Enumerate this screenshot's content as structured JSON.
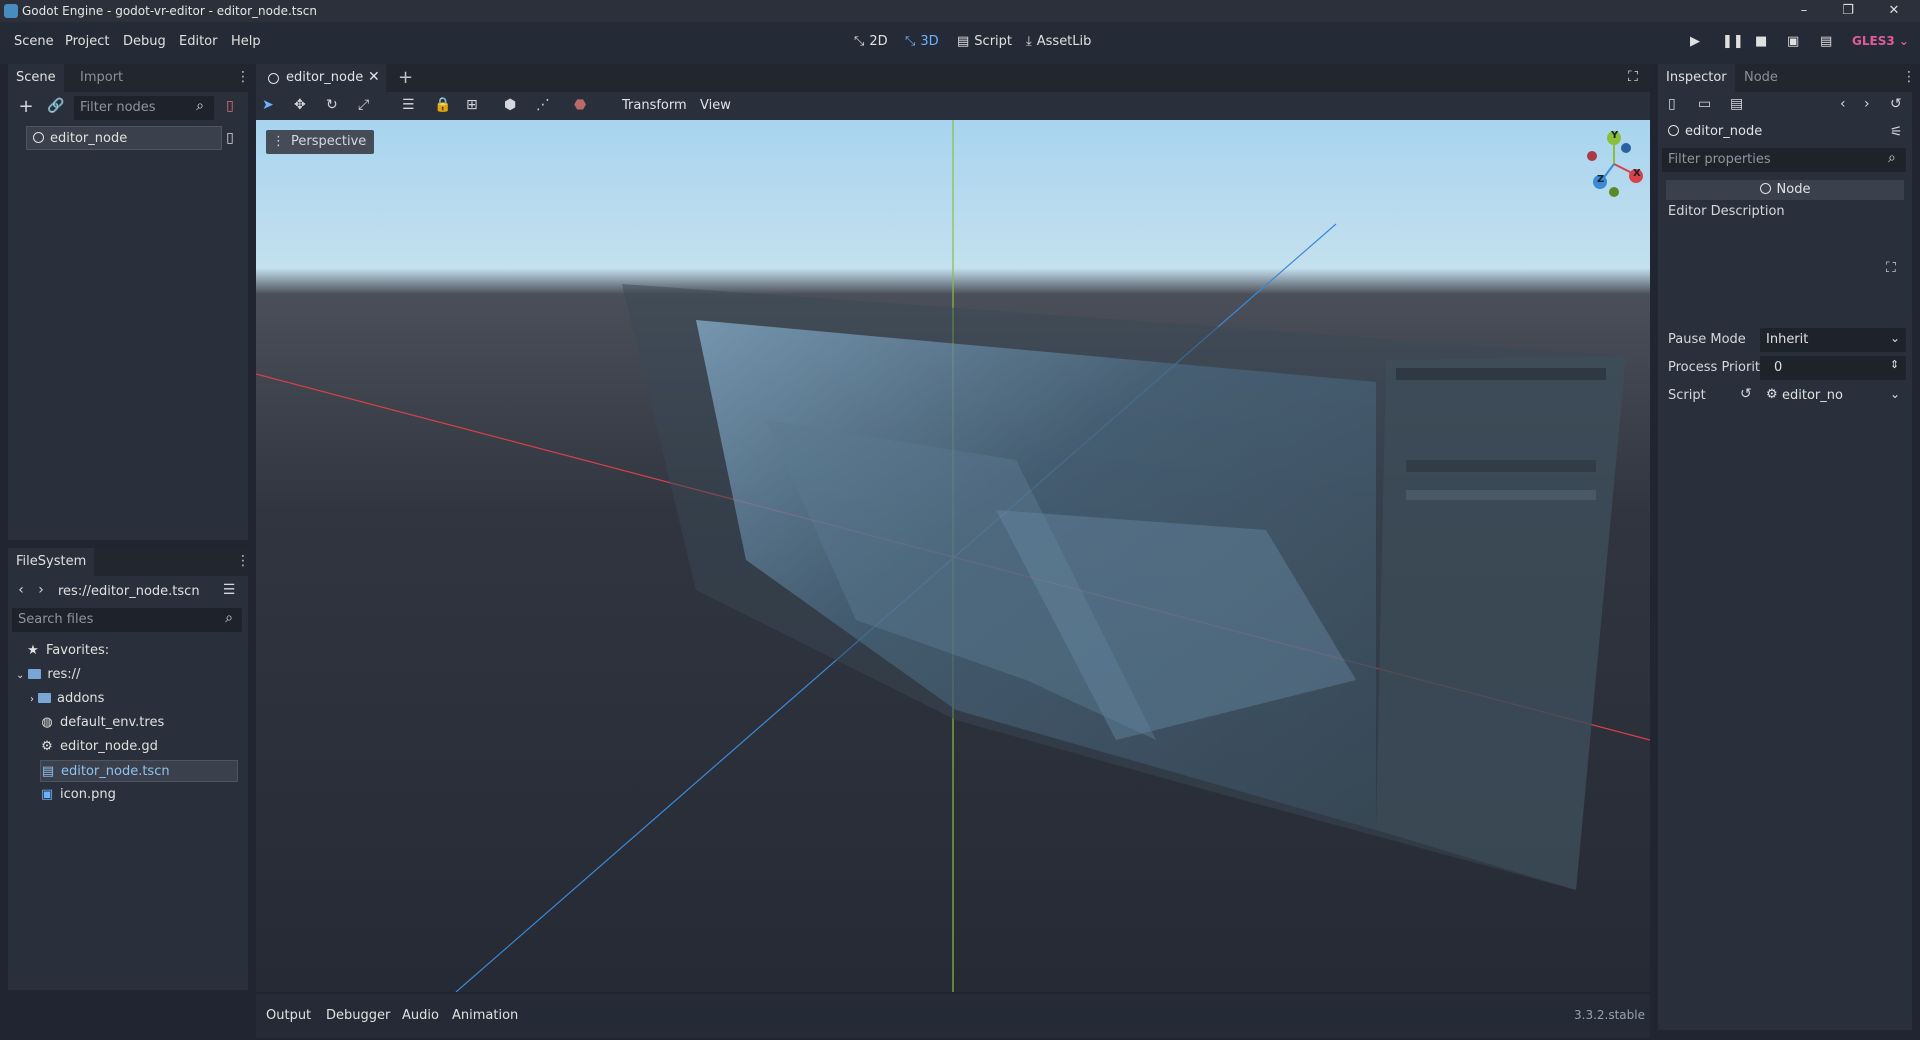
{
  "window": {
    "title": "Godot Engine - godot-vr-editor - editor_node.tscn"
  },
  "menu": {
    "items": [
      "Scene",
      "Project",
      "Debug",
      "Editor",
      "Help"
    ]
  },
  "workspaces": {
    "items": [
      "2D",
      "3D",
      "Script",
      "AssetLib"
    ],
    "active": "3D"
  },
  "renderer": {
    "label": "GLES3"
  },
  "scene_dock": {
    "tabs": [
      "Scene",
      "Import"
    ],
    "filter_placeholder": "Filter nodes",
    "root_node": "editor_node"
  },
  "filesystem": {
    "title": "FileSystem",
    "path": "res://editor_node.tscn",
    "search_placeholder": "Search files",
    "favorites": "Favorites:",
    "root": "res://",
    "entries": [
      {
        "name": "addons",
        "icon": "folder-icon"
      },
      {
        "name": "default_env.tres",
        "icon": "globe-icon"
      },
      {
        "name": "editor_node.gd",
        "icon": "gear-icon"
      },
      {
        "name": "editor_node.tscn",
        "icon": "clapperboard-icon",
        "selected": true
      },
      {
        "name": "icon.png",
        "icon": "image-icon"
      }
    ]
  },
  "editor_tabs": {
    "open": "editor_node"
  },
  "viewport_toolbar": {
    "menus": [
      "Transform",
      "View"
    ]
  },
  "viewport": {
    "perspective_label": "Perspective",
    "gizmo": {
      "x": "X",
      "y": "Y",
      "z": "Z"
    }
  },
  "inspector": {
    "tabs": [
      "Inspector",
      "Node"
    ],
    "object_name": "editor_node",
    "filter_placeholder": "Filter properties",
    "section": "Node",
    "editor_description_label": "Editor Description",
    "properties": [
      {
        "label": "Pause Mode",
        "value": "Inherit"
      },
      {
        "label": "Process Priority",
        "value": "0"
      },
      {
        "label": "Script",
        "value": "editor_no"
      }
    ]
  },
  "bottom_panel": {
    "tabs": [
      "Output",
      "Debugger",
      "Audio",
      "Animation"
    ],
    "version": "3.3.2.stable"
  },
  "colors": {
    "accent": "#478cbf",
    "renderer": "#e05b9b",
    "x_axis": "#d8404a",
    "y_axis": "#88c03a",
    "z_axis": "#3a8ad8"
  }
}
